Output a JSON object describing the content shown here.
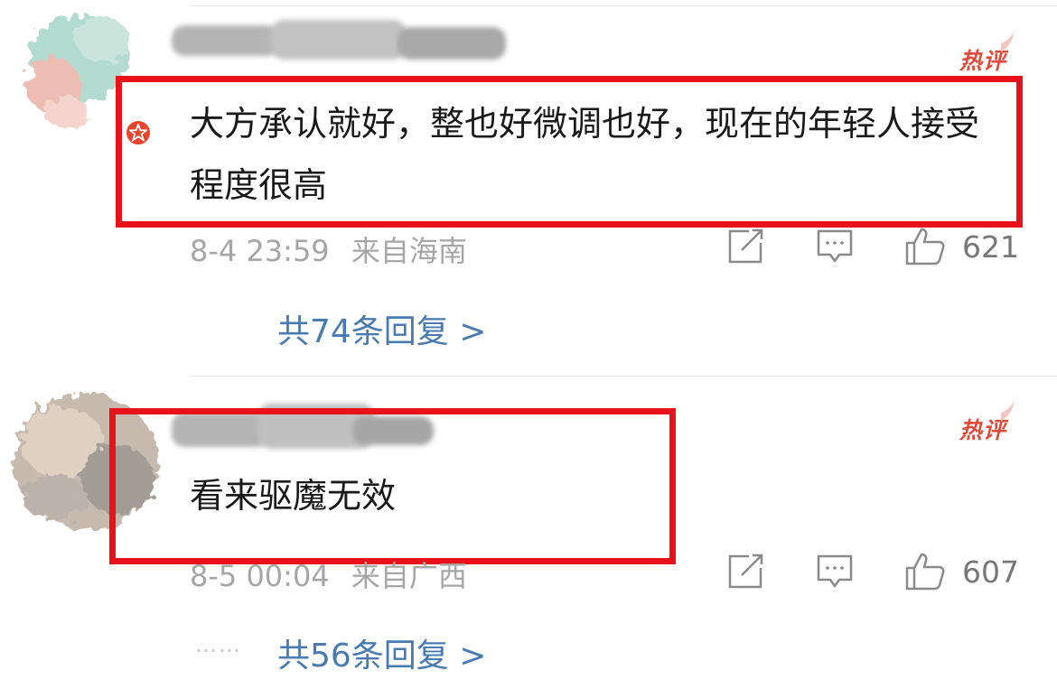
{
  "comments": [
    {
      "hot_label": "热评",
      "text": "大方承认就好，整也好微调也好，现在的年轻人接受程度很高",
      "time": "8-4 23:59",
      "location": "来自海南",
      "like_count": "621",
      "replies_label": "共74条回复 >"
    },
    {
      "hot_label": "热评",
      "text": "看来驱魔无效",
      "time": "8-5 00:04",
      "location": "来自广西",
      "like_count": "607",
      "replies_label": "共56条回复 >",
      "dots": "……"
    }
  ],
  "colors": {
    "highlight": "#e8121a",
    "hot": "#e04a3a",
    "link": "#4a7bb0",
    "meta": "#a6a6a6"
  },
  "icons": [
    "share-icon",
    "comment-icon",
    "like-icon",
    "star-badge-icon",
    "flame-icon"
  ]
}
